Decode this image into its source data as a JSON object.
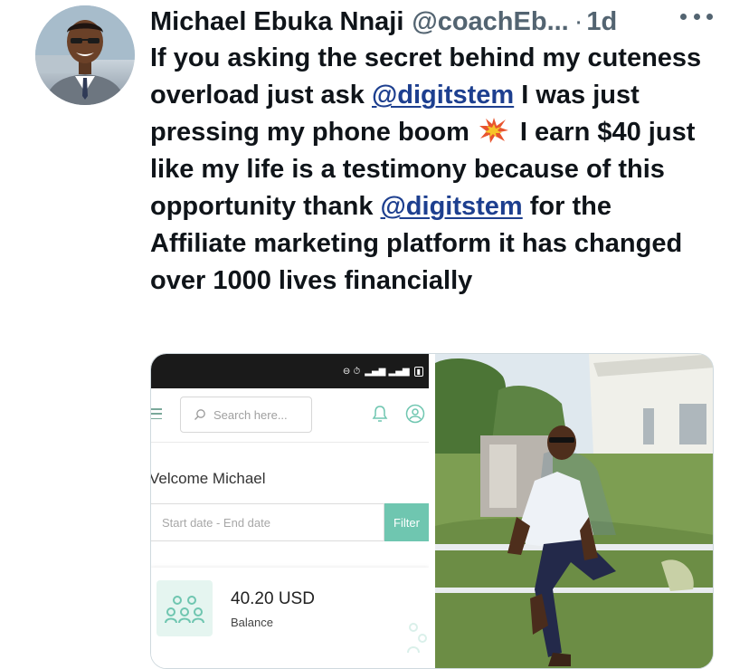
{
  "tweet": {
    "display_name": "Michael Ebuka Nnaji",
    "handle": "@coachEb...",
    "separator": "·",
    "time": "1d",
    "more_icon": "more-horizontal-icon",
    "text_parts": [
      "If you asking the secret behind my cuteness overload just ask ",
      "@digitstem",
      " I was just pressing my phone boom",
      " I earn $40 just like my life is a testimony because of this opportunity thank ",
      "@digitstem",
      " for the Affiliate marketing platform it has changed over 1000 lives financially"
    ],
    "mention_color": "#1d3f8f"
  },
  "screenshot_app": {
    "search_placeholder": "Search here...",
    "welcome": "Velcome Michael",
    "date_placeholder": "Start date - End date",
    "filter_label": "Filter",
    "balance_amount": "40.20 USD",
    "balance_label": "Balance",
    "accent_color": "#6fc6b0",
    "icons": [
      "menu-icon",
      "search-icon",
      "bell-icon",
      "account-icon",
      "people-icon"
    ]
  }
}
